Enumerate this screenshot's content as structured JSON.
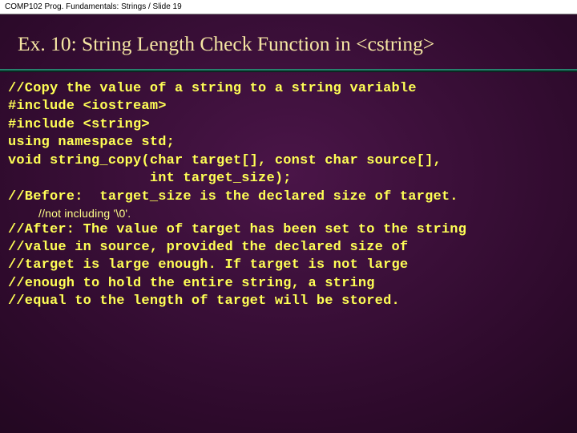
{
  "header": "COMP102 Prog. Fundamentals: Strings / Slide 19",
  "title": "Ex. 10: String Length Check Function in <cstring>",
  "code": {
    "l1": "//Copy the value of a string to a string variable",
    "l2": "#include <iostream>",
    "l3": "#include <string>",
    "l4": "using namespace std;",
    "l5": "void string_copy(char target[], const char source[],",
    "l6": "                 int target_size);",
    "l7": "//Before:  target_size is the declared size of target.",
    "l8": "//not including '\\0'.",
    "l9": "//After: The value of target has been set to the string",
    "l10": "//value in source, provided the declared size of",
    "l11": "//target is large enough. If target is not large",
    "l12": "//enough to hold the entire string, a string",
    "l13": "//equal to the length of target will be stored."
  }
}
